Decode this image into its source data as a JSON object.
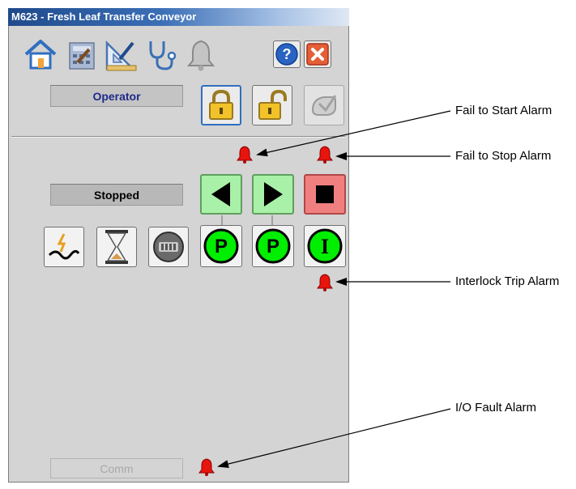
{
  "window": {
    "title": "M623 - Fresh Leaf Transfer Conveyor"
  },
  "tabs": [
    {
      "name": "home-icon"
    },
    {
      "name": "maintenance-icon"
    },
    {
      "name": "engineering-icon"
    },
    {
      "name": "diagnostics-icon"
    },
    {
      "name": "alarms-icon"
    }
  ],
  "header_buttons": {
    "help": "help-icon",
    "close": "close-icon"
  },
  "mode": {
    "current": "Operator",
    "lock_icon": "padlock-locked-icon",
    "unlock_icon": "padlock-unlocked-icon",
    "reset_icon": "reset-hand-icon"
  },
  "status": {
    "state": "Stopped"
  },
  "controls": {
    "reverse_icon": "triangle-left-icon",
    "forward_icon": "triangle-right-icon",
    "stop_icon": "stop-square-icon"
  },
  "indicators": {
    "energy_icon": "energy-icon",
    "timer_icon": "hourglass-icon",
    "overload_icon": "overload-icon",
    "permissive_reverse": "P",
    "permissive_forward": "P",
    "interlock": "I"
  },
  "comm": {
    "label": "Comm"
  },
  "colors": {
    "alarm_bell": "#e8140e",
    "permissive_green": "#00ee00",
    "start_button_green": "#a9f0a9",
    "stop_button_red": "#f08080",
    "title_bar_blue": "#1f4a8c"
  },
  "annotations": {
    "fail_to_start": "Fail to Start Alarm",
    "fail_to_stop": "Fail to Stop Alarm",
    "interlock_trip": "Interlock Trip Alarm",
    "io_fault": "I/O Fault Alarm"
  }
}
